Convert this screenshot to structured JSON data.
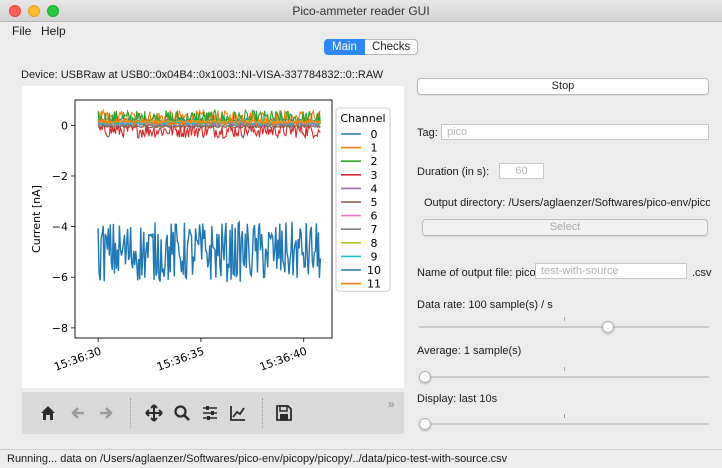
{
  "window": {
    "title": "Pico-ammeter reader GUI"
  },
  "menu": [
    "File",
    "Help"
  ],
  "tabs": [
    {
      "label": "Main"
    },
    {
      "label": "Checks"
    }
  ],
  "device_text": "Device: USBRaw at USB0::0x04B4::0x1003::NI-VISA-337784832::0::RAW",
  "toolbar_icons": [
    "home-icon",
    "back-arrow-icon",
    "forward-arrow-icon",
    "pan-icon",
    "zoom-icon",
    "configure-subplots-icon",
    "edit-axis-icon",
    "save-icon",
    "overflow-chevron-icon"
  ],
  "controls": {
    "stop_label": "Stop",
    "tag_label": "Tag:",
    "tag_placeholder": "pico",
    "duration_label": "Duration (in s):",
    "duration_value": "60",
    "output_dir_label": "Output directory: /Users/aglaenzer/Softwares/pico-env/picopy/",
    "select_label": "Select",
    "filename_label": "Name of output file: pico-",
    "filename_placeholder": "test-with-source",
    "filename_ext": ".csv",
    "data_rate_label": "Data rate: 100 sample(s) / s",
    "data_rate_fraction": 0.66,
    "average_label": "Average: 1 sample(s)",
    "average_fraction": 0.0,
    "display_label": "Display: last 10s",
    "display_fraction": 0.0
  },
  "status": "Running... data on /Users/aglaenzer/Softwares/pico-env/picopy/picopy/../data/pico-test-with-source.csv",
  "chart_data": {
    "type": "line",
    "ylabel": "Current [nA]",
    "xlabel": "",
    "xlim": [
      0,
      10
    ],
    "ylim": [
      -8.4,
      1.0
    ],
    "x_ticks": [
      {
        "label": "15:36:30",
        "value": 0.9
      },
      {
        "label": "15:36:35",
        "value": 4.9
      },
      {
        "label": "15:36:40",
        "value": 8.9
      }
    ],
    "y_ticks": [
      0,
      -2,
      -4,
      -6,
      -8
    ],
    "legend_title": "Channel",
    "legend_position": "right",
    "series": [
      {
        "name": "0",
        "color": "#1f77b4",
        "mean": 0.2,
        "amp": 0.08
      },
      {
        "name": "1",
        "color": "#ff7f0e",
        "mean": 0.3,
        "amp": 0.3
      },
      {
        "name": "2",
        "color": "#2ca02c",
        "mean": 0.25,
        "amp": 0.35
      },
      {
        "name": "3",
        "color": "#d62728",
        "mean": -0.2,
        "amp": 0.3
      },
      {
        "name": "4",
        "color": "#9467bd",
        "mean": 0.05,
        "amp": 0.05
      },
      {
        "name": "5",
        "color": "#8c564b",
        "mean": -0.05,
        "amp": 0.04
      },
      {
        "name": "6",
        "color": "#e377c2",
        "mean": 0.1,
        "amp": 0.04
      },
      {
        "name": "7",
        "color": "#7f7f7f",
        "mean": 0.0,
        "amp": 0.04
      },
      {
        "name": "8",
        "color": "#bcbd22",
        "mean": 0.15,
        "amp": 0.04
      },
      {
        "name": "9",
        "color": "#17becf",
        "mean": 0.08,
        "amp": 0.04
      },
      {
        "name": "10",
        "color": "#1f77b4",
        "mean": -5.0,
        "amp": 1.2
      },
      {
        "name": "11",
        "color": "#ff7f0e",
        "mean": 0.12,
        "amp": 0.1
      }
    ]
  }
}
